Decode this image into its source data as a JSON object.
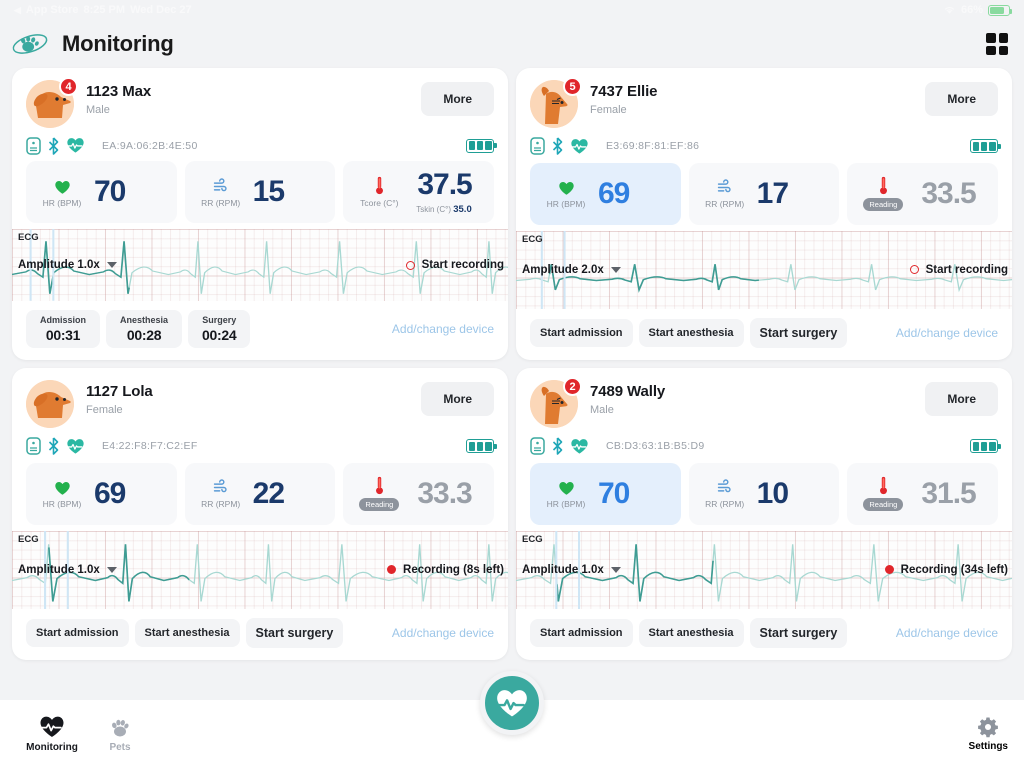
{
  "statusbar": {
    "back_label": "App Store",
    "time": "8:25 PM",
    "date": "Wed Dec 27",
    "battery_percent": "66%",
    "wifi_icon": "wifi-icon",
    "battery_icon": "battery-icon"
  },
  "header": {
    "title": "Monitoring",
    "logo_icon": "paw-orbit-logo-icon",
    "grid_icon": "grid-view-icon"
  },
  "cards": [
    {
      "id": "1123 Max",
      "sex": "Male",
      "badge": "4",
      "avatar_icon": "dog-avatar-icon",
      "more_label": "More",
      "device_icons": [
        "monitor-device-icon",
        "bluetooth-icon",
        "heart-pulse-icon"
      ],
      "mac": "EA:9A:06:2B:4E:50",
      "battery_bars": 3,
      "hr": {
        "label": "HR (BPM)",
        "value": "70",
        "icon": "heart-icon",
        "active": false
      },
      "rr": {
        "label": "RR (RPM)",
        "value": "15",
        "icon": "wind-icon"
      },
      "temp": {
        "label": "Tcore (C°)",
        "value": "37.5",
        "icon": "thermometer-icon",
        "sub_label": "Tskin (C°)",
        "sub_value": "35.0",
        "pill": false,
        "dim": false
      },
      "ecg": {
        "title": "ECG",
        "amplitude": "Amplitude 1.0x",
        "recording_label": "Start recording",
        "recording": false
      },
      "actions": {
        "type": "timers",
        "timers": [
          {
            "label": "Admission",
            "value": "00:31"
          },
          {
            "label": "Anesthesia",
            "value": "00:28"
          },
          {
            "label": "Surgery",
            "value": "00:24"
          }
        ],
        "add_device_label": "Add/change device"
      }
    },
    {
      "id": "7437 Ellie",
      "sex": "Female",
      "badge": "5",
      "avatar_icon": "cat-avatar-icon",
      "more_label": "More",
      "device_icons": [
        "monitor-device-icon",
        "bluetooth-icon",
        "heart-pulse-icon"
      ],
      "mac": "E3:69:8F:81:EF:86",
      "battery_bars": 3,
      "hr": {
        "label": "HR (BPM)",
        "value": "69",
        "icon": "heart-icon",
        "active": true
      },
      "rr": {
        "label": "RR (RPM)",
        "value": "17",
        "icon": "wind-icon"
      },
      "temp": {
        "label": "Reading",
        "value": "33.5",
        "icon": "thermometer-icon",
        "sub_label": "",
        "sub_value": "",
        "pill": true,
        "dim": true
      },
      "ecg": {
        "title": "ECG",
        "amplitude": "Amplitude 2.0x",
        "recording_label": "Start recording",
        "recording": false
      },
      "actions": {
        "type": "buttons",
        "buttons": [
          "Start admission",
          "Start anesthesia",
          "Start surgery"
        ],
        "add_device_label": "Add/change device"
      }
    },
    {
      "id": "1127 Lola",
      "sex": "Female",
      "badge": "",
      "avatar_icon": "dog-avatar-icon",
      "more_label": "More",
      "device_icons": [
        "monitor-device-icon",
        "bluetooth-icon",
        "heart-pulse-icon"
      ],
      "mac": "E4:22:F8:F7:C2:EF",
      "battery_bars": 3,
      "hr": {
        "label": "HR (BPM)",
        "value": "69",
        "icon": "heart-icon",
        "active": false
      },
      "rr": {
        "label": "RR (RPM)",
        "value": "22",
        "icon": "wind-icon"
      },
      "temp": {
        "label": "Reading",
        "value": "33.3",
        "icon": "thermometer-icon",
        "sub_label": "",
        "sub_value": "",
        "pill": true,
        "dim": true
      },
      "ecg": {
        "title": "ECG",
        "amplitude": "Amplitude 1.0x",
        "recording_label": "Recording (8s left)",
        "recording": true
      },
      "actions": {
        "type": "buttons",
        "buttons": [
          "Start admission",
          "Start anesthesia",
          "Start surgery"
        ],
        "add_device_label": "Add/change device"
      }
    },
    {
      "id": "7489 Wally",
      "sex": "Male",
      "badge": "2",
      "avatar_icon": "cat-avatar-icon",
      "more_label": "More",
      "device_icons": [
        "monitor-device-icon",
        "bluetooth-icon",
        "heart-pulse-icon"
      ],
      "mac": "CB:D3:63:1B:B5:D9",
      "battery_bars": 3,
      "hr": {
        "label": "HR (BPM)",
        "value": "70",
        "icon": "heart-icon",
        "active": true
      },
      "rr": {
        "label": "RR (RPM)",
        "value": "10",
        "icon": "wind-icon"
      },
      "temp": {
        "label": "Reading",
        "value": "31.5",
        "icon": "thermometer-icon",
        "sub_label": "",
        "sub_value": "",
        "pill": true,
        "dim": true
      },
      "ecg": {
        "title": "ECG",
        "amplitude": "Amplitude 1.0x",
        "recording_label": "Recording (34s left)",
        "recording": true
      },
      "actions": {
        "type": "buttons",
        "buttons": [
          "Start admission",
          "Start anesthesia",
          "Start surgery"
        ],
        "add_device_label": "Add/change device"
      }
    }
  ],
  "tabbar": {
    "monitoring_label": "Monitoring",
    "monitoring_icon": "heart-pulse-icon",
    "pets_label": "Pets",
    "pets_icon": "paw-icon",
    "settings_label": "Settings",
    "settings_icon": "gear-icon",
    "fab_icon": "heart-pulse-icon"
  },
  "colors": {
    "accent_teal": "#3aa99f",
    "alert_red": "#e0262b",
    "value_navy": "#1b3a6b",
    "value_blue": "#2f7fe0",
    "muted_gray": "#9aa0a8"
  }
}
